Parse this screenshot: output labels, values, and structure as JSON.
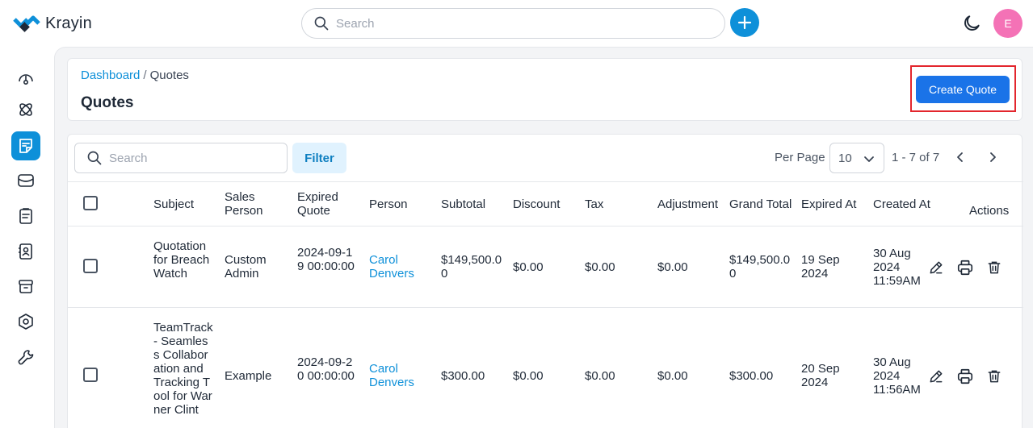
{
  "app": {
    "name": "Krayin"
  },
  "search": {
    "placeholder": "Search"
  },
  "user": {
    "initial": "E",
    "avatar_color": "#f472b6"
  },
  "colors": {
    "primary": "#0e90d9",
    "button": "#1a73e8",
    "highlight": "#e3262d"
  },
  "sidebar": {
    "items": [
      {
        "icon": "dashboard-icon",
        "active": false
      },
      {
        "icon": "leads-icon",
        "active": false
      },
      {
        "icon": "quotes-icon",
        "active": true
      },
      {
        "icon": "mail-icon",
        "active": false
      },
      {
        "icon": "activities-icon",
        "active": false
      },
      {
        "icon": "contacts-icon",
        "active": false
      },
      {
        "icon": "products-icon",
        "active": false
      },
      {
        "icon": "settings-icon",
        "active": false
      },
      {
        "icon": "configuration-icon",
        "active": false
      }
    ]
  },
  "breadcrumb": {
    "home": "Dashboard",
    "separator": "/",
    "current": "Quotes"
  },
  "page": {
    "title": "Quotes",
    "create_label": "Create Quote"
  },
  "toolbar": {
    "search_placeholder": "Search",
    "filter_label": "Filter",
    "per_page_label": "Per Page",
    "per_page_value": "10",
    "page_range": "1 - 7 of 7"
  },
  "table": {
    "columns": [
      "Subject",
      "Sales Person",
      "Expired Quote",
      "Person",
      "Subtotal",
      "Discount",
      "Tax",
      "Adjustment",
      "Grand Total",
      "Expired At",
      "Created At",
      "Actions"
    ],
    "rows": [
      {
        "subject": "Quotation for BreachWatch",
        "sales_person": "Custom Admin",
        "expired_quote": "2024-09-19 00:00:00",
        "person": "Carol Denvers",
        "subtotal": "$149,500.00",
        "discount": "$0.00",
        "tax": "$0.00",
        "adjustment": "$0.00",
        "grand_total": "$149,500.00",
        "expired_at": "19 Sep 2024",
        "created_at": "30 Aug 2024 11:59AM"
      },
      {
        "subject": "TeamTrack - Seamless Collaboration and Tracking Tool for Warner Clint",
        "sales_person": "Example",
        "expired_quote": "2024-09-20 00:00:00",
        "person": "Carol Denvers",
        "subtotal": "$300.00",
        "discount": "$0.00",
        "tax": "$0.00",
        "adjustment": "$0.00",
        "grand_total": "$300.00",
        "expired_at": "20 Sep 2024",
        "created_at": "30 Aug 2024 11:56AM"
      }
    ]
  }
}
